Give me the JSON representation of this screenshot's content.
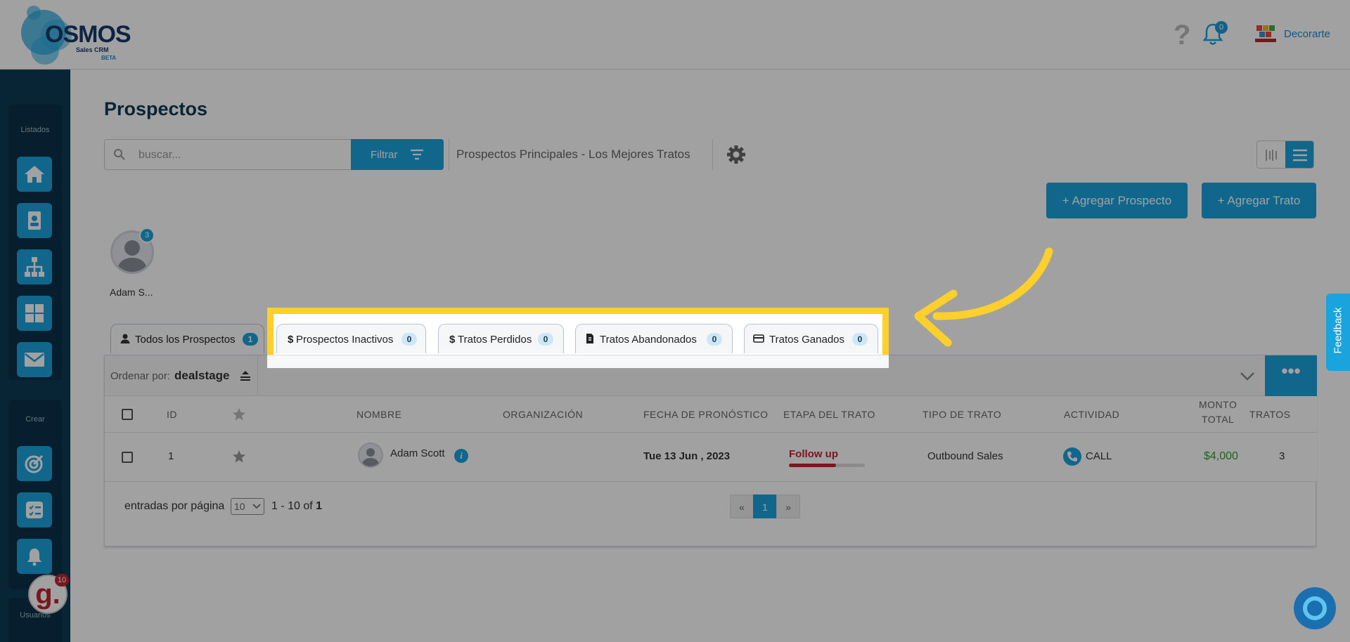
{
  "header": {
    "logo_text": "OSMOS",
    "logo_sub": "Sales CRM",
    "logo_beta": "BETA",
    "notifications_count": "0",
    "company_name": "Decorarte"
  },
  "sidebar": {
    "group_listados": "Listados",
    "group_crear": "Crear",
    "group_usuarios": "Usuarios",
    "listados_items": [
      {
        "icon": "home-icon"
      },
      {
        "icon": "contacts-icon"
      },
      {
        "icon": "org-chart-icon"
      },
      {
        "icon": "grid-icon"
      },
      {
        "icon": "mail-icon"
      }
    ],
    "crear_items": [
      {
        "icon": "target-icon"
      },
      {
        "icon": "checklist-icon"
      },
      {
        "icon": "alarm-bell-icon"
      }
    ],
    "guide_badge_letter": "g.",
    "guide_badge_count": "10"
  },
  "page": {
    "title": "Prospectos",
    "search_placeholder": "buscar...",
    "filter_label": "Filtrar",
    "pipeline_label": "Prospectos Principales - Los Mejores Tratos",
    "add_prospect_label": "+ Agregar Prospecto",
    "add_deal_label": "+ Agregar Trato"
  },
  "owner": {
    "name": "Adam S...",
    "count": "3"
  },
  "tabs": [
    {
      "label": "Todos los Prospectos",
      "count": "1",
      "icon": "user-icon",
      "active": true
    },
    {
      "label": "Prospectos Inactivos",
      "count": "0",
      "icon": "dollar-icon",
      "active": false
    },
    {
      "label": "Tratos Perdidos",
      "count": "0",
      "icon": "dollar-icon",
      "active": false
    },
    {
      "label": "Tratos Abandonados",
      "count": "0",
      "icon": "document-icon",
      "active": false
    },
    {
      "label": "Tratos Ganados",
      "count": "0",
      "icon": "credit-card-icon",
      "active": false
    }
  ],
  "sort": {
    "label": "Ordenar por:",
    "value": "dealstage",
    "more_label": "•••"
  },
  "table": {
    "headers": {
      "id": "ID",
      "name": "NOMBRE",
      "organization": "ORGANIZACIÓN",
      "forecast_date": "FECHA DE PRONÓSTICO",
      "stage": "ETAPA DEL TRATO",
      "deal_type": "TIPO DE TRATO",
      "activity": "ACTIVIDAD",
      "total_amount_1": "MONTO",
      "total_amount_2": "TOTAL",
      "deals": "TRATOS"
    },
    "rows": [
      {
        "id": "1",
        "name": "Adam Scott",
        "organization": "",
        "forecast_date": "Tue 13 Jun , 2023",
        "stage": "Follow up",
        "stage_progress": 0.62,
        "deal_type": "Outbound Sales",
        "activity": "CALL",
        "total_amount": "$4,000",
        "deals": "3"
      }
    ]
  },
  "pagination": {
    "entries_label": "entradas por página",
    "per_page": "10",
    "range": "1 - 10 of",
    "total": "1",
    "prev": "«",
    "current": "1",
    "next": "»"
  },
  "feedback_label": "Feedback",
  "colors": {
    "accent": "#1aa3dd",
    "sidebar": "#0d3b55",
    "highlight": "#ffd02b",
    "stage_red": "#c0272d",
    "amount_green": "#2ea12e"
  }
}
